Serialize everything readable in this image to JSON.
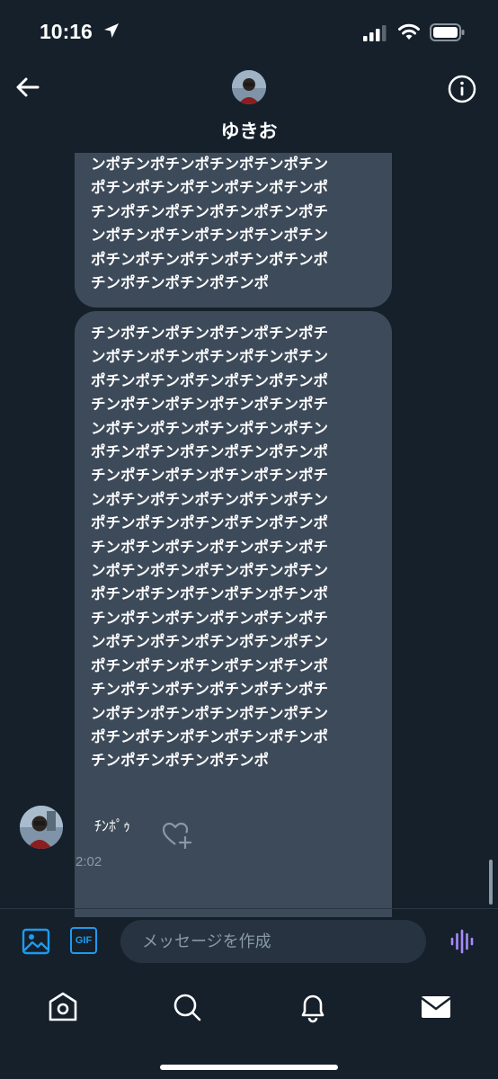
{
  "status_bar": {
    "time": "10:16"
  },
  "header": {
    "contact_name": "ゆきお"
  },
  "messages": {
    "first_bubble_lines": [
      "ンポチンポチンポチンポチンポチン",
      "ポチンポチンポチンポチンポチンポ",
      "チンポチンポチンポチンポチンポチ",
      "ンポチンポチンポチンポチンポチン",
      "ポチンポチンポチンポチンポチンポ",
      "チンポチンポチンポチンポ"
    ],
    "second_bubble_lines": [
      "チンポチンポチンポチンポチンポチ",
      "ンポチンポチンポチンポチンポチン",
      "ポチンポチンポチンポチンポチンポ",
      "チンポチンポチンポチンポチンポチ",
      "ンポチンポチンポチンポチンポチン",
      "ポチンポチンポチンポチンポチンポ",
      "チンポチンポチンポチンポチンポチ",
      "ンポチンポチンポチンポチンポチン",
      "ポチンポチンポチンポチンポチンポ",
      "チンポチンポチンポチンポチンポチ",
      "ンポチンポチンポチンポチンポチン",
      "ポチンポチンポチンポチンポチンポ",
      "チンポチンポチンポチンポチンポチ",
      "ンポチンポチンポチンポチンポチン",
      "ポチンポチンポチンポチンポチンポ",
      "チンポチンポチンポチンポチンポチ",
      "ンポチンポチンポチンポチンポチン",
      "ポチンポチンポチンポチンポチンポ",
      "チンポチンポチンポチンポ"
    ],
    "last_message": "ﾁﾝﾎﾟｩ",
    "timestamp": "2:02"
  },
  "composer": {
    "placeholder": "メッセージを作成",
    "gif_label": "GIF"
  },
  "icons": {
    "back": "back-arrow-icon",
    "info": "info-icon",
    "image": "image-icon",
    "gif": "gif-icon",
    "voice": "voice-icon",
    "like": "heart-plus-icon",
    "tab_home": "home-icon",
    "tab_search": "search-icon",
    "tab_notifications": "bell-icon",
    "tab_messages": "mail-icon"
  },
  "colors": {
    "background": "#15202b",
    "bubble": "#3d4a59",
    "accent": "#1d9bf0",
    "voice": "#a78bfa",
    "muted": "#8899a6"
  }
}
